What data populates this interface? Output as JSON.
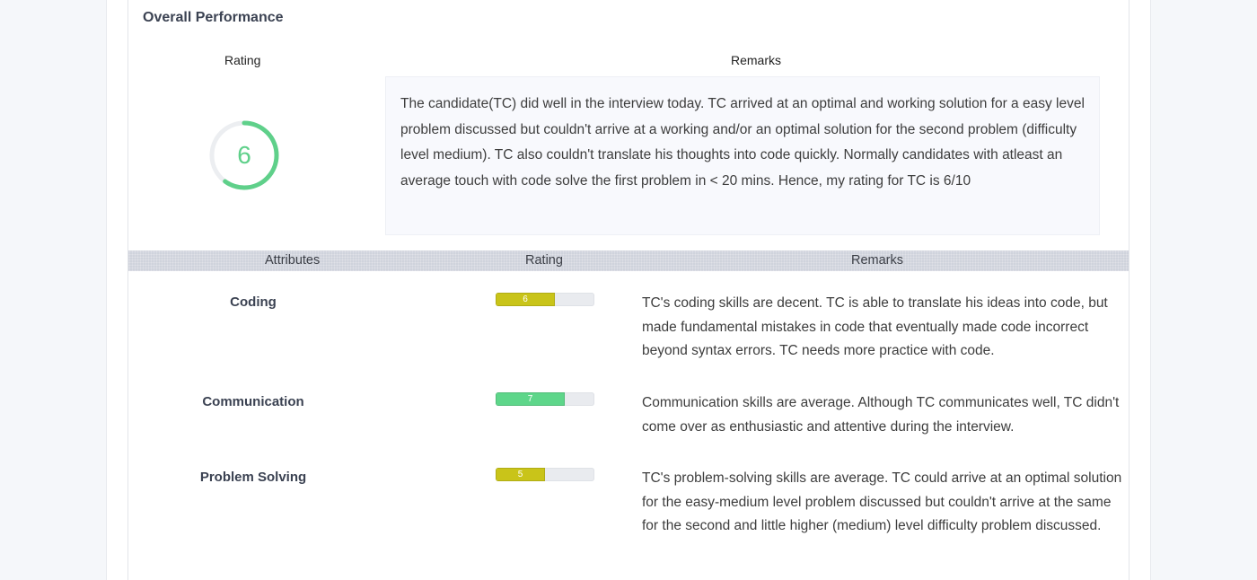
{
  "section": {
    "title": "Overall Performance"
  },
  "overall": {
    "rating_label": "Rating",
    "remarks_label": "Remarks",
    "score": "6",
    "score_fraction": 0.6,
    "ring_color": "#5fd08a",
    "remarks": "The candidate(TC) did well in the interview today. TC arrived at an optimal and working solution for a easy level problem discussed but couldn't arrive at a working and/or an optimal solution for the second problem (difficulty level medium). TC also couldn't translate his thoughts into code quickly. Normally candidates with atleast an average touch with code solve the first problem in < 20 mins. Hence, my rating for TC is 6/10"
  },
  "attributes_table": {
    "headers": {
      "attributes": "Attributes",
      "rating": "Rating",
      "remarks": "Remarks"
    },
    "rows": [
      {
        "name": "Coding",
        "rating": "6",
        "fraction": 0.6,
        "color": "#c9c419",
        "remark": "TC's coding skills are decent. TC is able to translate his ideas into code, but made fundamental mistakes in code that eventually made code incorrect beyond syntax errors. TC needs more practice with code."
      },
      {
        "name": "Communication",
        "rating": "7",
        "fraction": 0.7,
        "color": "#5ed68a",
        "remark": "Communication skills are average. Although TC communicates well, TC didn't come over as enthusiastic and attentive during the interview."
      },
      {
        "name": "Problem Solving",
        "rating": "5",
        "fraction": 0.5,
        "color": "#c9c419",
        "remark": "TC's problem-solving skills are average. TC could arrive at an optimal solution for the easy-medium level problem discussed but couldn't arrive at the same for the second and little higher (medium) level difficulty problem discussed."
      }
    ]
  }
}
